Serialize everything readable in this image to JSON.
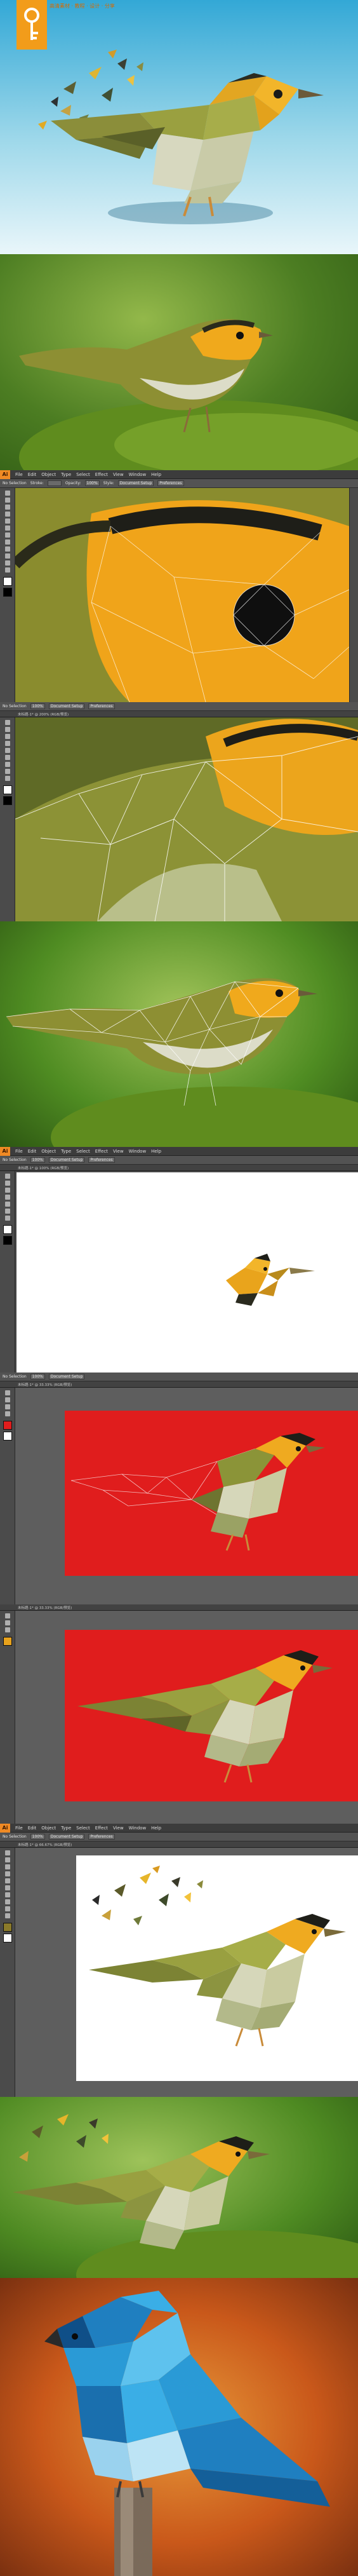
{
  "header": {
    "site_text": "高清素材 · 教程 · 设计 · 分享",
    "logo_icon": "key-brand-icon",
    "brand_color": "#f29c1a"
  },
  "illustrator": {
    "app_icon": "Ai",
    "menu": [
      "File",
      "Edit",
      "Object",
      "Type",
      "Select",
      "Effect",
      "View",
      "Window",
      "Help"
    ],
    "control": {
      "selection_label": "No Selection",
      "stroke_label": "Stroke:",
      "opacity_label": "Opacity:",
      "opacity_value": "100%",
      "style_label": "Style:",
      "doc_setup": "Document Setup",
      "preferences": "Preferences"
    },
    "doc_tabs": {
      "tab1": "未标题-1* @ 200% (RGB/预览)",
      "tab2": "未标题-1* @ 100% (RGB/预览)",
      "tab3": "未标题-1* @ 33.33% (RGB/预览)",
      "tab4": "未标题-1* @ 66.67% (RGB/预览)"
    }
  },
  "colors": {
    "sky_top": "#1f9fd1",
    "sky_bottom": "#d6f0f7",
    "green_bg": "#4f8c2a",
    "moss": "#6f9a2a",
    "bird_yellow": "#f0b020",
    "bird_olive": "#8a9a38",
    "bird_belly": "#d8dcc0",
    "red_canvas": "#e01d1d",
    "blue_bird": "#2aa3e0",
    "autumn": "#d8731e"
  }
}
